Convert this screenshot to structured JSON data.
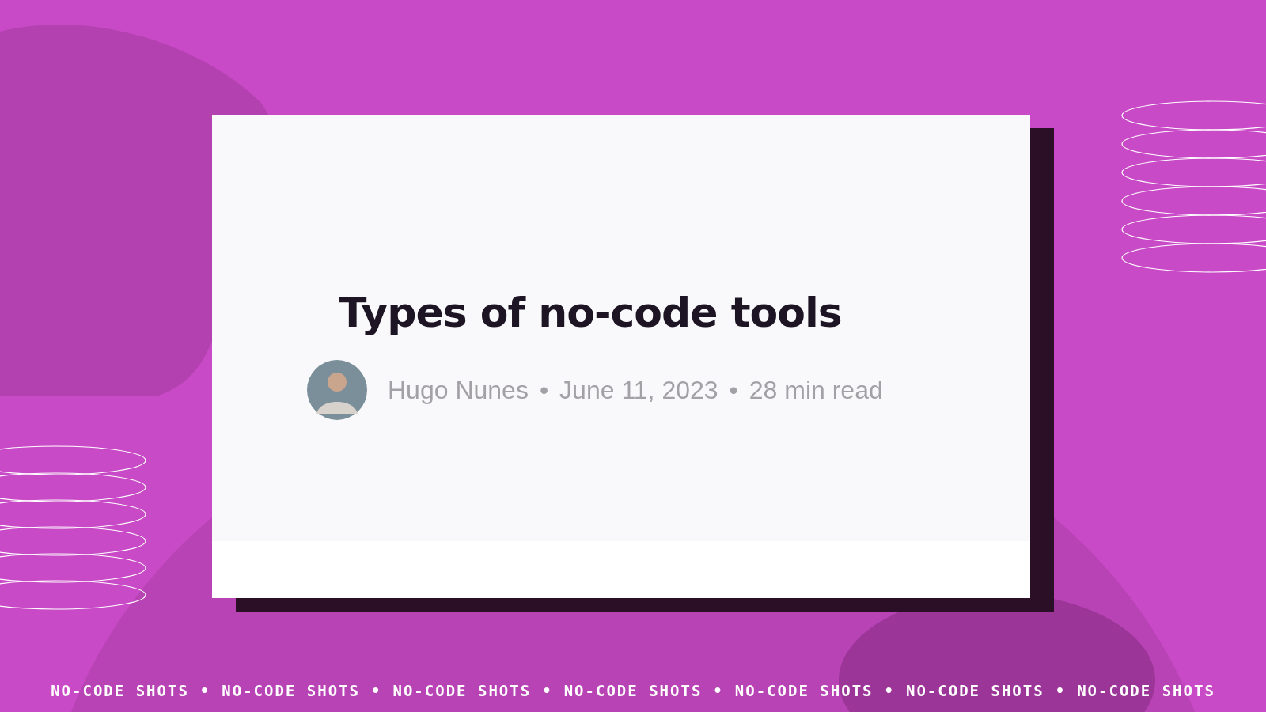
{
  "article_card": {
    "title": "Types of no-code tools",
    "meta": {
      "author": "Hugo Nunes",
      "separator": "•",
      "date": "June 11, 2023",
      "read_time": "28 min read"
    }
  },
  "footer": {
    "separator": "•",
    "items": [
      "NO-CODE SHOTS",
      "NO-CODE SHOTS",
      "NO-CODE SHOTS",
      "NO-CODE SHOTS",
      "NO-CODE SHOTS",
      "NO-CODE SHOTS",
      "NO-CODE SHOTS"
    ]
  }
}
